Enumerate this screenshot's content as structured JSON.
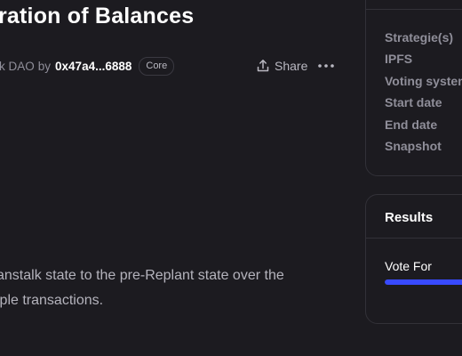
{
  "proposal": {
    "title": "ration of Balances",
    "space_name": "k DAO",
    "by_label": "by",
    "author": "0x47a4...6888",
    "author_badge": "Core",
    "share_label": "Share",
    "more_icon": "more-horizontal-icon",
    "share_icon": "share-upload-icon",
    "body_lines": [
      "anstalk state to the pre-Replant state over the",
      "iple transactions."
    ]
  },
  "sidebar": {
    "info_items": [
      "Strategie(s)",
      "IPFS",
      "Voting system",
      "Start date",
      "End date",
      "Snapshot"
    ],
    "results": {
      "title": "Results",
      "choices": [
        {
          "label": "Vote For",
          "percent": 100
        }
      ]
    }
  },
  "colors": {
    "background": "#1c1b20",
    "border": "#323138",
    "muted_text": "#8f8e99",
    "progress_fill": "#384aff"
  }
}
